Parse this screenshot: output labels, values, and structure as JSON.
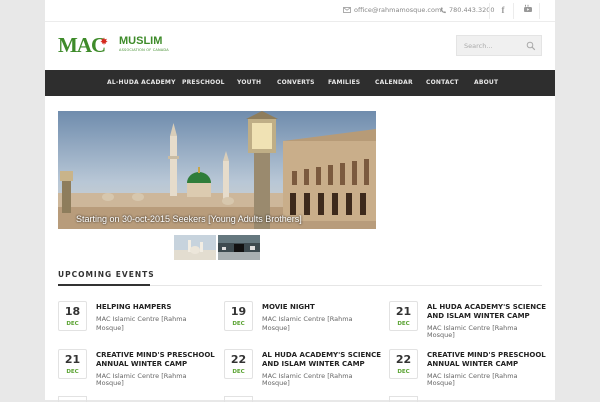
{
  "topbar": {
    "email": "office@rahmamosque.com",
    "phone": "780.443.3200",
    "facebook_glyph": "f",
    "youtube_glyph": "▶"
  },
  "logo": {
    "mac": "MAC",
    "muslim": "MUSLIM",
    "association": "ASSOCIATION OF CANADA"
  },
  "search": {
    "placeholder": "Search..."
  },
  "nav": {
    "items": [
      {
        "label": "AL-HUDA ACADEMY"
      },
      {
        "label": "PRESCHOOL"
      },
      {
        "label": "YOUTH"
      },
      {
        "label": "CONVERTS"
      },
      {
        "label": "FAMILIES"
      },
      {
        "label": "CALENDAR"
      },
      {
        "label": "CONTACT"
      },
      {
        "label": "ABOUT"
      }
    ]
  },
  "slider": {
    "caption": "Starting on 30-oct-2015 Seekers [Young Adults Brothers]"
  },
  "events": {
    "heading": "UPCOMING EVENTS",
    "items": [
      {
        "day": "18",
        "month": "DEC",
        "title": "HELPING HAMPERS",
        "venue_line1": "MAC Islamic Centre [Rahma",
        "venue_line2": "Mosque]"
      },
      {
        "day": "19",
        "month": "DEC",
        "title": "MOVIE NIGHT",
        "venue_line1": "MAC Islamic Centre [Rahma",
        "venue_line2": "Mosque]"
      },
      {
        "day": "21",
        "month": "DEC",
        "title": "AL HUDA ACADEMY'S SCIENCE AND ISLAM WINTER CAMP",
        "venue_line1": "MAC Islamic Centre [Rahma",
        "venue_line2": "Mosque]"
      },
      {
        "day": "21",
        "month": "DEC",
        "title": "CREATIVE MIND'S PRESCHOOL ANNUAL WINTER CAMP",
        "venue_line1": "MAC Islamic Centre [Rahma",
        "venue_line2": "Mosque]"
      },
      {
        "day": "22",
        "month": "DEC",
        "title": "AL HUDA ACADEMY'S SCIENCE AND ISLAM WINTER CAMP",
        "venue_line1": "MAC Islamic Centre [Rahma",
        "venue_line2": "Mosque]"
      },
      {
        "day": "22",
        "month": "DEC",
        "title": "CREATIVE MIND'S PRESCHOOL ANNUAL WINTER CAMP",
        "venue_line1": "MAC Islamic Centre [Rahma",
        "venue_line2": "Mosque]"
      }
    ]
  },
  "colors": {
    "brand_green": "#3e8b2a",
    "nav_bg": "#2e2e2e",
    "month_green": "#5aa332"
  }
}
